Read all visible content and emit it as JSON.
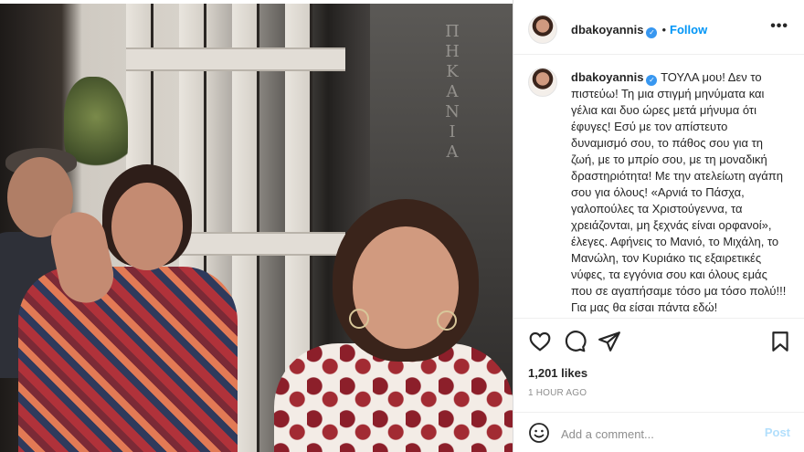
{
  "post": {
    "username": "dbakoyannis",
    "verified_badge": "✓",
    "dot": "•",
    "follow_label": "Follow",
    "more_label": "•••",
    "caption_text": "ΤΟΥΛΑ μου! Δεν το πιστεύω! Τη μια στιγμή μηνύματα και γέλια και δυο ώρες μετά μήνυμα ότι έφυγες! Εσύ με τον απίστευτο δυναμισμό σου, το πάθος σου για τη ζωή, με το μπρίο σου, με τη μοναδική δραστηριότητα! Με την ατελείωτη αγάπη σου για όλους! «Αρνιά το Πάσχα, γαλοπούλες τα Χριστούγεννα, τα χρειάζονται, μη ξεχνάς είναι ορφανοί», έλεγες. Αφήνεις το Μανιό, το Μιχάλη, το Μανώλη, τον Κυριάκο τις εξαιρετικές νύφες, τα εγγόνια σου και όλους εμάς που σε αγαπήσαμε τόσο μα τόσο πολύ!!! Για μας θα είσαι πάντα εδώ!",
    "likes": "1,201 likes",
    "timestamp": "1 HOUR AGO",
    "comment_placeholder": "Add a comment...",
    "post_label": "Post",
    "photo_sign_text": "ΠΗΚΑΝΙΑ"
  },
  "colors": {
    "accent": "#0095f6",
    "verified": "#3897f0",
    "post_disabled": "#b2dffc",
    "muted": "#8e8e8e",
    "text": "#262626"
  },
  "icons": {
    "like": "heart-icon",
    "comment": "comment-icon",
    "share": "paper-plane-icon",
    "save": "bookmark-icon",
    "emoji": "smiley-icon",
    "more": "more-options-icon"
  }
}
